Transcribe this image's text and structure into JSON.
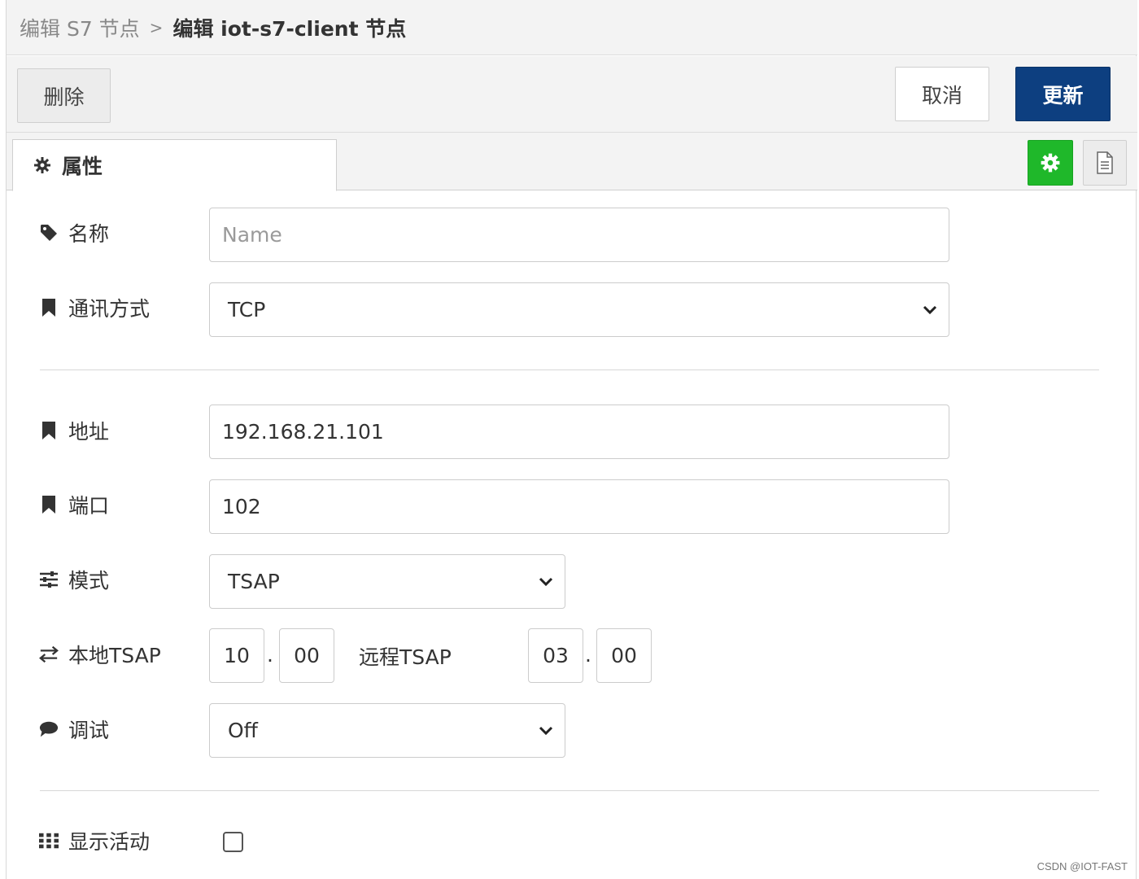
{
  "breadcrumb": {
    "parent": "编辑 S7 节点",
    "separator": ">",
    "current": "编辑 iot-s7-client 节点"
  },
  "toolbar": {
    "delete_label": "删除",
    "cancel_label": "取消",
    "update_label": "更新"
  },
  "tabs": {
    "properties_label": "属性"
  },
  "form": {
    "name": {
      "label": "名称",
      "value": "",
      "placeholder": "Name"
    },
    "comm_mode": {
      "label": "通讯方式",
      "value": "TCP"
    },
    "address": {
      "label": "地址",
      "value": "192.168.21.101"
    },
    "port": {
      "label": "端口",
      "value": "102"
    },
    "mode": {
      "label": "模式",
      "value": "TSAP"
    },
    "tsap": {
      "local_label": "本地TSAP",
      "local_1": "10",
      "local_2": "00",
      "dot": ".",
      "remote_label": "远程TSAP",
      "remote_1": "03",
      "remote_2": "00"
    },
    "debug": {
      "label": "调试",
      "value": "Off"
    },
    "show_activity": {
      "label": "显示活动",
      "checked": false
    }
  },
  "colors": {
    "update_button": "#0d3f80",
    "green_button": "#1fb82a",
    "header_bg": "#f3f3f3"
  },
  "watermark": "CSDN @IOT-FAST"
}
